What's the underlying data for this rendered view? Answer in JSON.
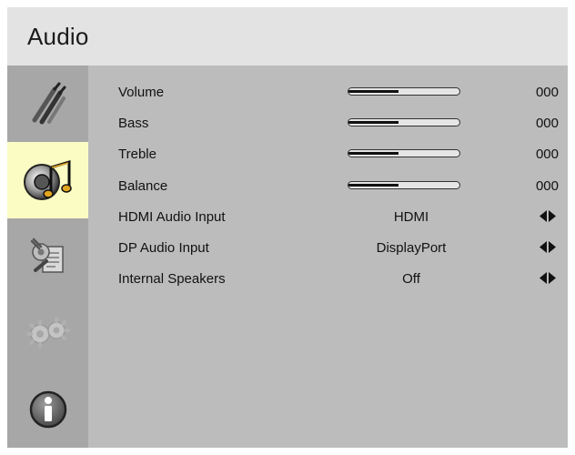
{
  "header": {
    "title": "Audio"
  },
  "sidebar": {
    "items": [
      {
        "icon": "cables-icon",
        "active": false
      },
      {
        "icon": "audio-note-icon",
        "active": true
      },
      {
        "icon": "settings-document-icon",
        "active": false
      },
      {
        "icon": "gears-icon",
        "active": false
      },
      {
        "icon": "info-icon",
        "active": false
      }
    ]
  },
  "menu": {
    "rows": [
      {
        "label": "Volume",
        "value": "000",
        "level": 0.45
      },
      {
        "label": "Bass",
        "value": "000",
        "level": 0.45
      },
      {
        "label": "Treble",
        "value": "000",
        "level": 0.45
      },
      {
        "label": "Balance",
        "value": "000",
        "level": 0.45
      },
      {
        "label": "HDMI Audio Input",
        "option": "HDMI"
      },
      {
        "label": "DP Audio Input",
        "option": "DisplayPort"
      },
      {
        "label": "Internal Speakers",
        "option": "Off"
      }
    ]
  },
  "colors": {
    "title_bar": "#e3e3e3",
    "sidebar": "#a7a7a7",
    "content": "#bcbcbc",
    "active_item": "#fbfbc4"
  }
}
